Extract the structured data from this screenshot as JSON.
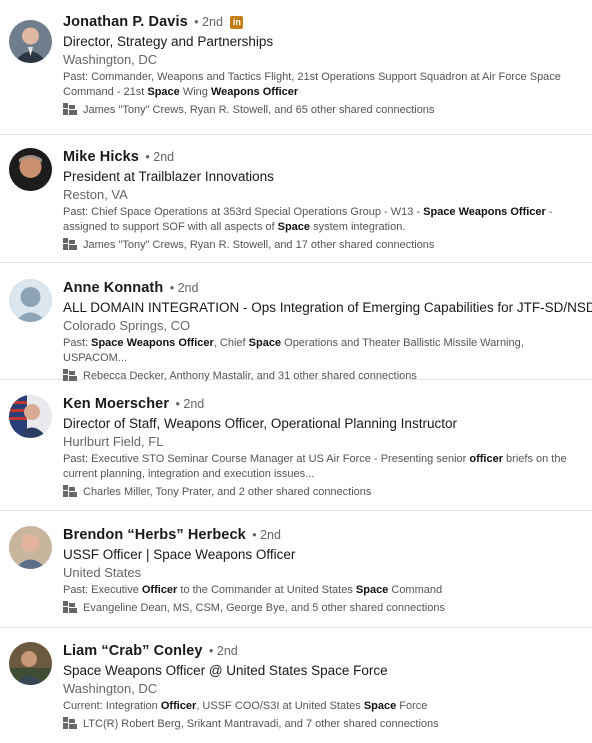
{
  "results": [
    {
      "name": "Jonathan P. Davis",
      "degree": "• 2nd",
      "badge": "in",
      "headline": "Director, Strategy and Partnerships",
      "location": "Washington, DC",
      "snippet": [
        {
          "t": "Past: Commander, Weapons and Tactics Flight, 21st Operations Support Squadron at Air Force Space Command - 21st ",
          "b": false
        },
        {
          "t": "Space",
          "b": true
        },
        {
          "t": " Wing ",
          "b": false
        },
        {
          "t": "Weapons Officer",
          "b": true
        }
      ],
      "shared": "James \"Tony\" Crews, Ryan R. Stowell, and 65 other shared connections",
      "avatar_style": "suit"
    },
    {
      "name": "Mike Hicks",
      "degree": "• 2nd",
      "badge": "",
      "headline": "President at Trailblazer Innovations",
      "location": "Reston, VA",
      "snippet": [
        {
          "t": "Past: Chief Space Operations at 353rd Special Operations Group - W13 - ",
          "b": false
        },
        {
          "t": "Space Weapons Officer",
          "b": true
        },
        {
          "t": " - assigned to support SOF with all aspects of ",
          "b": false
        },
        {
          "t": "Space",
          "b": true
        },
        {
          "t": " system integration.",
          "b": false
        }
      ],
      "shared": "James \"Tony\" Crews, Ryan R. Stowell, and 17 other shared connections",
      "avatar_style": "dark"
    },
    {
      "name": "Anne Konnath",
      "degree": "• 2nd",
      "badge": "",
      "headline": "ALL DOMAIN INTEGRATION - Ops Integration of Emerging Capabilities for JTF-SD/NSDC",
      "location": "Colorado Springs, CO",
      "snippet": [
        {
          "t": "Past: ",
          "b": false
        },
        {
          "t": "Space Weapons Officer",
          "b": true
        },
        {
          "t": ", Chief ",
          "b": false
        },
        {
          "t": "Space",
          "b": true
        },
        {
          "t": " Operations and Theater Ballistic Missile Warning, USPACOM...",
          "b": false
        }
      ],
      "shared": "Rebecca Decker, Anthony Mastalir, and 31 other shared connections",
      "avatar_style": "placeholder"
    },
    {
      "name": "Ken Moerscher",
      "degree": "• 2nd",
      "badge": "",
      "headline": "Director of Staff, Weapons Officer, Operational Planning Instructor",
      "location": "Hurlburt Field, FL",
      "snippet": [
        {
          "t": "Past: Executive STO Seminar Course Manager at US Air Force - Presenting senior ",
          "b": false
        },
        {
          "t": "officer",
          "b": true
        },
        {
          "t": " briefs on the current planning, integration and execution issues...",
          "b": false
        }
      ],
      "shared": "Charles Miller, Tony Prater, and 2 other shared connections",
      "avatar_style": "flag"
    },
    {
      "name": "Brendon “Herbs” Herbeck",
      "degree": "• 2nd",
      "badge": "",
      "headline": "USSF Officer | Space Weapons Officer",
      "location": "United States",
      "snippet": [
        {
          "t": "Past: Executive ",
          "b": false
        },
        {
          "t": "Officer",
          "b": true
        },
        {
          "t": " to the Commander at United States ",
          "b": false
        },
        {
          "t": "Space",
          "b": true
        },
        {
          "t": " Command",
          "b": false
        }
      ],
      "shared": "Evangeline Dean, MS, CSM, George Bye, and 5 other shared connections",
      "avatar_style": "light"
    },
    {
      "name": "Liam “Crab” Conley",
      "degree": "• 2nd",
      "badge": "",
      "headline": "Space Weapons Officer @ United States Space Force",
      "location": "Washington, DC",
      "snippet": [
        {
          "t": "Current: Integration ",
          "b": false
        },
        {
          "t": "Officer",
          "b": true
        },
        {
          "t": ", USSF COO/S3I at United States ",
          "b": false
        },
        {
          "t": "Space",
          "b": true
        },
        {
          "t": " Force",
          "b": false
        }
      ],
      "shared": "LTC(R) Robert Berg, Srikant Mantravadi, and 7 other shared connections",
      "avatar_style": "outdoor"
    }
  ],
  "icons": {
    "shared_connections": "people-icon",
    "linkedin_badge": "linkedin-badge-icon"
  },
  "colors": {
    "badge": "#c37d16",
    "divider": "#e4e4e4",
    "secondary_text": "#666666"
  }
}
